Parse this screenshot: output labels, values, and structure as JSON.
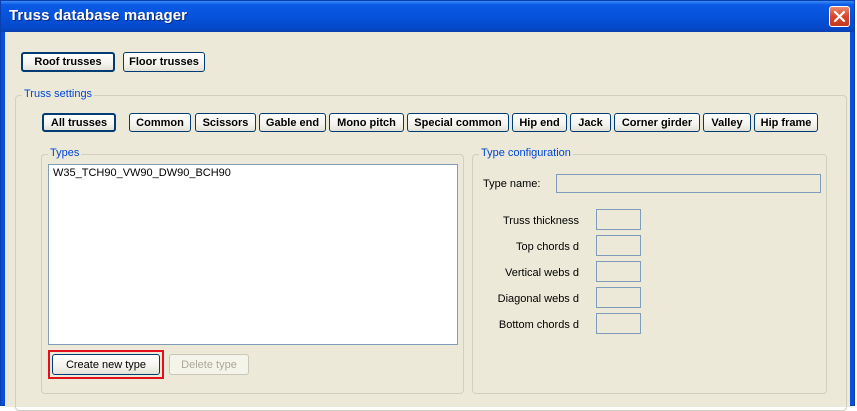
{
  "window": {
    "title": "Truss database manager"
  },
  "top_tabs": {
    "roof": "Roof trusses",
    "floor": "Floor trusses"
  },
  "truss_settings": {
    "legend": "Truss settings",
    "filters": [
      "All trusses",
      "Common",
      "Scissors",
      "Gable end",
      "Mono pitch",
      "Special common",
      "Hip end",
      "Jack",
      "Corner girder",
      "Valley",
      "Hip frame"
    ]
  },
  "types": {
    "legend": "Types",
    "items": [
      "W35_TCH90_VW90_DW90_BCH90"
    ],
    "create_label": "Create new type",
    "delete_label": "Delete type"
  },
  "type_config": {
    "legend": "Type configuration",
    "name_label": "Type name:",
    "name_value": "",
    "fields": [
      {
        "label": "Truss thickness",
        "value": ""
      },
      {
        "label": "Top chords d",
        "value": ""
      },
      {
        "label": "Vertical webs d",
        "value": ""
      },
      {
        "label": "Diagonal webs d",
        "value": ""
      },
      {
        "label": "Bottom chords d",
        "value": ""
      }
    ]
  },
  "colors": {
    "titlebar": "#0653db",
    "accent_red": "#e3101b",
    "legend_blue": "#0046d5",
    "dialog_bg": "#ece9d8"
  },
  "icons": {
    "close": "close-icon"
  }
}
